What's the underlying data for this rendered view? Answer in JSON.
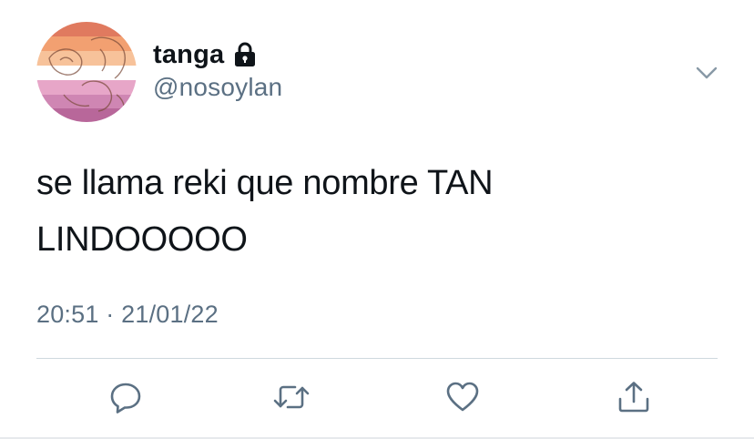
{
  "user": {
    "display_name": "tanga",
    "handle": "@nosoylan",
    "avatar_icon": "avatar-lesbian-flag-drawing",
    "protected_icon": "lock-icon"
  },
  "tweet": {
    "text_line1": "se llama reki que nombre TAN",
    "text_line2": "LINDOOOOO",
    "timestamp": "20:51 · 21/01/22"
  },
  "actions": {
    "reply_icon": "reply-icon",
    "retweet_icon": "retweet-icon",
    "like_icon": "heart-icon",
    "share_icon": "share-icon"
  },
  "colors": {
    "text_primary": "#0f1419",
    "text_secondary": "#5b7083",
    "divider": "#cfd9de",
    "flag_1": "#d62900",
    "flag_2": "#ef7627",
    "flag_3": "#ff9b55",
    "flag_4": "#ffffff",
    "flag_5": "#d462a5",
    "flag_6": "#b55690",
    "flag_7": "#a50062"
  }
}
